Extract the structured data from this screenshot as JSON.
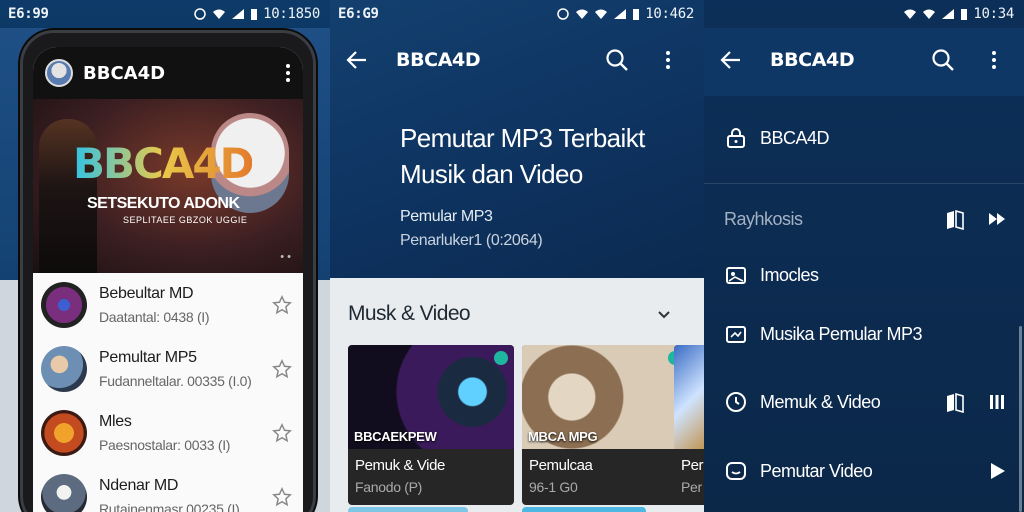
{
  "status_bars": [
    {
      "time": "E6:99",
      "clock": "10:1850"
    },
    {
      "time": "E6:G9",
      "clock": "10:462"
    },
    {
      "time": "",
      "clock": "10:34"
    }
  ],
  "phone": {
    "app_title": "BBCA4D",
    "banner": {
      "logo": "BBCA4D",
      "subtitle": "SETSEKUTO ADONK",
      "tagline": "SEPLITAEE GBZOK UGGIE"
    },
    "list": [
      {
        "name": "Bebeultar MD",
        "meta": "Daatantal: 0438 (I)"
      },
      {
        "name": "Pemultar MP5",
        "meta": "Fudanneltalar. 00335 (I.0)"
      },
      {
        "name": "Mles",
        "meta": "Paesnostalar: 0033 (I)"
      },
      {
        "name": "Ndenar MD",
        "meta": "Rutainenmasr 00235 (I)"
      }
    ]
  },
  "detail": {
    "app_title": "BBCA4D",
    "headline": "Pemutar MP3 Terbaikt Musik dan Video",
    "subtitle": "Pemular MP3",
    "version": "Penarluker1 (0:2064)",
    "section": "Musk & Video",
    "cards": [
      {
        "caption": "BBCAEKPEW",
        "title": "Pemuk & Vide",
        "meta": "Fanodo (P)"
      },
      {
        "caption": "MBCA MPG",
        "title": "Pemulcaa",
        "meta": "96-1 G0"
      },
      {
        "caption": "",
        "title": "Per",
        "meta": "Per"
      }
    ]
  },
  "menu": {
    "app_title": "BBCA4D",
    "items": [
      {
        "label": "BBCA4D",
        "icon": "lock-icon"
      },
      {
        "label": "Rayhkosis",
        "icon": ""
      },
      {
        "label": "Imocles",
        "icon": "image-icon"
      },
      {
        "label": "Musika Pemular MP3",
        "icon": "video-icon"
      },
      {
        "label": "Memuk & Video",
        "icon": "clock-icon"
      },
      {
        "label": "Pemutar Video",
        "icon": "chat-icon"
      }
    ]
  },
  "colors": {
    "accent": "#4fb7e3",
    "panel_dark": "#0c2f59",
    "teal_badge": "#1fb6a0"
  }
}
